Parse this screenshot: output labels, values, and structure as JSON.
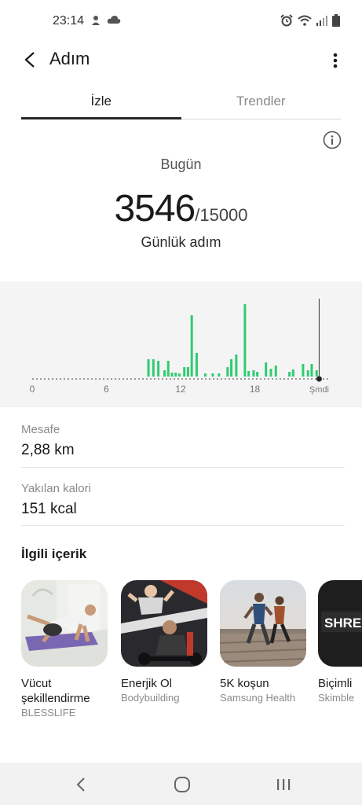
{
  "status_bar": {
    "time": "23:14",
    "left_icons": [
      "notification-icon",
      "cloud-icon"
    ],
    "right_icons": [
      "alarm-icon",
      "wifi-icon",
      "signal-icon",
      "battery-icon"
    ]
  },
  "app_bar": {
    "title": "Adım"
  },
  "tabs": [
    {
      "label": "İzle",
      "active": true
    },
    {
      "label": "Trendler",
      "active": false
    }
  ],
  "summary": {
    "period": "Bugün",
    "steps": "3546",
    "goal": "/15000",
    "label": "Günlük adım"
  },
  "chart_data": {
    "type": "bar",
    "x_ticks": [
      "0",
      "6",
      "12",
      "18",
      "Şmdi"
    ],
    "bar_color": "#2ecc71",
    "values": [
      {
        "hour": 9.4,
        "steps": 22
      },
      {
        "hour": 9.8,
        "steps": 22
      },
      {
        "hour": 10.2,
        "steps": 20
      },
      {
        "hour": 10.7,
        "steps": 8
      },
      {
        "hour": 11.0,
        "steps": 20
      },
      {
        "hour": 11.3,
        "steps": 5
      },
      {
        "hour": 11.6,
        "steps": 5
      },
      {
        "hour": 11.9,
        "steps": 4
      },
      {
        "hour": 12.3,
        "steps": 12
      },
      {
        "hour": 12.6,
        "steps": 12
      },
      {
        "hour": 12.9,
        "steps": 78
      },
      {
        "hour": 13.3,
        "steps": 30
      },
      {
        "hour": 14.0,
        "steps": 4
      },
      {
        "hour": 14.6,
        "steps": 4
      },
      {
        "hour": 15.1,
        "steps": 4
      },
      {
        "hour": 15.8,
        "steps": 12
      },
      {
        "hour": 16.1,
        "steps": 22
      },
      {
        "hour": 16.5,
        "steps": 28
      },
      {
        "hour": 17.2,
        "steps": 92
      },
      {
        "hour": 17.5,
        "steps": 7
      },
      {
        "hour": 17.9,
        "steps": 8
      },
      {
        "hour": 18.2,
        "steps": 6
      },
      {
        "hour": 18.9,
        "steps": 18
      },
      {
        "hour": 19.3,
        "steps": 10
      },
      {
        "hour": 19.7,
        "steps": 14
      },
      {
        "hour": 20.8,
        "steps": 6
      },
      {
        "hour": 21.1,
        "steps": 9
      },
      {
        "hour": 21.9,
        "steps": 16
      },
      {
        "hour": 22.3,
        "steps": 8
      },
      {
        "hour": 22.6,
        "steps": 16
      },
      {
        "hour": 23.0,
        "steps": 8
      }
    ],
    "now_hour": 23.2,
    "y_max": 100,
    "x_range": [
      0,
      24
    ]
  },
  "metrics": [
    {
      "label": "Mesafe",
      "value": "2,88 km"
    },
    {
      "label": "Yakılan kalori",
      "value": "151 kcal"
    }
  ],
  "related": {
    "title": "İlgili içerik",
    "items": [
      {
        "title": "Vücut şekillendirme",
        "source": "BLESSLIFE"
      },
      {
        "title": "Enerjik Ol",
        "source": "Bodybuilding"
      },
      {
        "title": "5K koşun",
        "source": "Samsung Health"
      },
      {
        "title": "Biçimli",
        "source": "Skimble",
        "image_text": "SHRE"
      }
    ]
  },
  "nav_bar": {
    "buttons": [
      "back-nav-icon",
      "home-nav-icon",
      "recents-nav-icon"
    ]
  }
}
